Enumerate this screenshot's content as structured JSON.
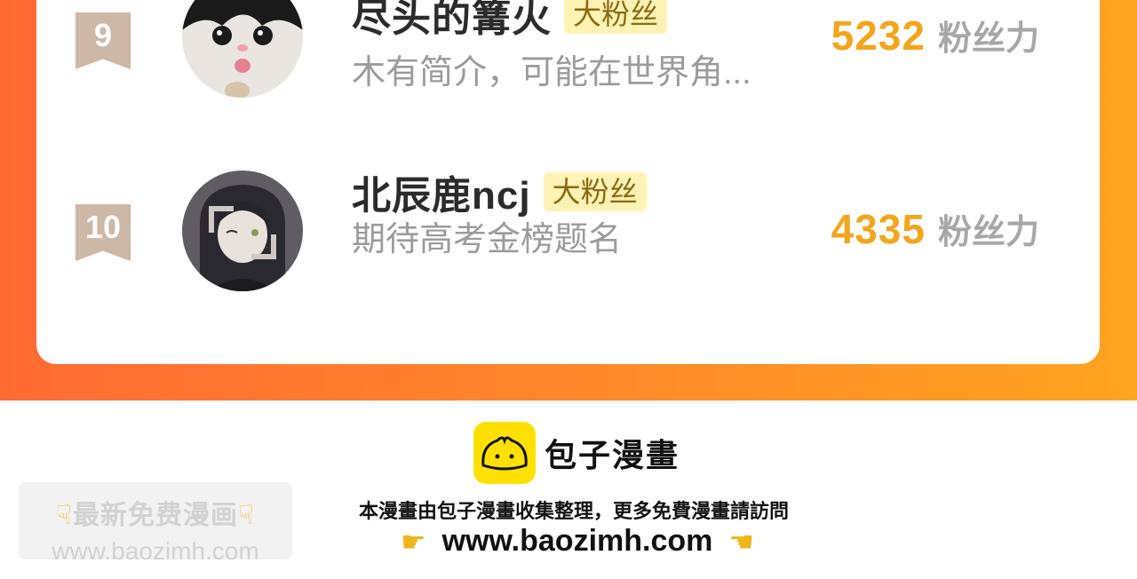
{
  "leaderboard": {
    "entries": [
      {
        "rank": "9",
        "name": "尽头的篝火",
        "badge": "大粉丝",
        "bio": "木有简介，可能在世界角...",
        "score": "5232",
        "score_unit": "粉丝力",
        "avatar_icon": "cat-avatar-icon"
      },
      {
        "rank": "10",
        "name": "北辰鹿ncj",
        "badge": "大粉丝",
        "bio": "期待高考金榜题名",
        "score": "4335",
        "score_unit": "粉丝力",
        "avatar_icon": "girl-avatar-icon"
      }
    ]
  },
  "footer": {
    "brand": "包子漫畫",
    "note": "本漫畫由包子漫畫收集整理，更多免費漫畫請訪問",
    "url": "www.baozimh.com",
    "hand_icon": "pointing-hand-icon"
  },
  "promo": {
    "title": "最新免费漫画",
    "url": "www.baozimh.com",
    "hand_icon": "pointing-down-hand-icon"
  },
  "colors": {
    "band_start": "#ff6a33",
    "band_end": "#ffa41f",
    "score": "#f3a51c",
    "badge_bg": "#fff2b5",
    "logo_yellow": "#ffe000"
  }
}
